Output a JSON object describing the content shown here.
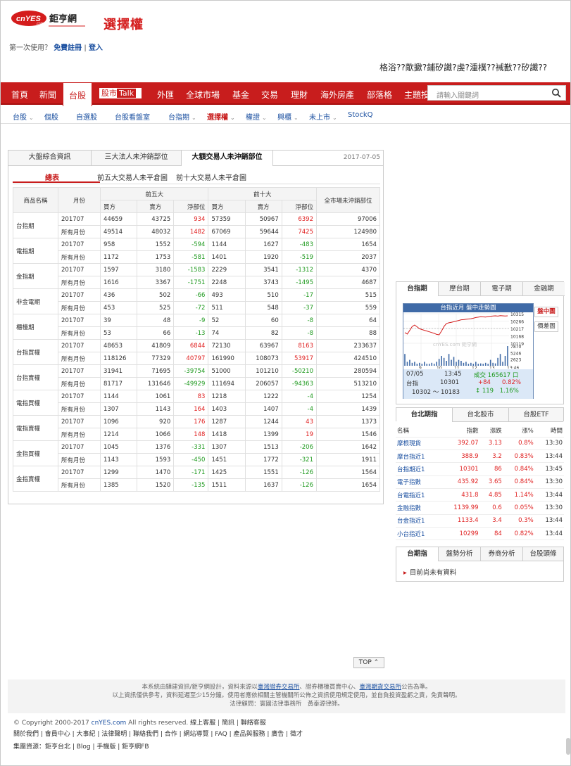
{
  "header": {
    "logo_text": "cnYES.com 鉅亨網",
    "title": "選擇權",
    "first_time": "第一次使用？",
    "register": "免費註冊",
    "sep": "|",
    "login": "登入",
    "garbled": "格浴??歒擨?鋪矽讖?虔?湩樸??裓敾??矽讖??"
  },
  "nav": {
    "items": [
      "首頁",
      "新聞",
      "台股",
      "股市",
      "外匯",
      "全球市場",
      "基金",
      "交易",
      "理財",
      "海外房產",
      "部落格",
      "主題投"
    ],
    "active": "台股",
    "talk": "Talk",
    "search_placeholder": "請輸入關鍵詞"
  },
  "subnav": [
    "台股",
    "個股",
    "自選股",
    "台股看盤室",
    "台指期",
    "選擇權",
    "權證",
    "興櫃",
    "未上市",
    "StockQ"
  ],
  "panel": {
    "tabs": [
      "大盤綜合資訊",
      "三大法人未沖銷部位",
      "大額交易人未沖銷部位"
    ],
    "date": "2017-07-05",
    "subtabs": [
      "總表",
      "前五大交易人未平倉圖",
      "前十大交易人未平倉圖"
    ]
  },
  "table": {
    "h_name": "商品名稱",
    "h_month": "月份",
    "h_top5": "前五大",
    "h_top10": "前十大",
    "h_total": "全市場未沖銷部位",
    "h_buy": "買方",
    "h_sell": "賣方",
    "h_net": "淨部位",
    "rows": [
      {
        "name": "台指期",
        "r": [
          [
            "201707",
            "44659",
            "43725",
            "934",
            "57359",
            "50967",
            "6392",
            "97006"
          ],
          [
            "所有月份",
            "49514",
            "48032",
            "1482",
            "67069",
            "59644",
            "7425",
            "124980"
          ]
        ]
      },
      {
        "name": "電指期",
        "r": [
          [
            "201707",
            "958",
            "1552",
            "-594",
            "1144",
            "1627",
            "-483",
            "1654"
          ],
          [
            "所有月份",
            "1172",
            "1753",
            "-581",
            "1401",
            "1920",
            "-519",
            "2037"
          ]
        ]
      },
      {
        "name": "金指期",
        "r": [
          [
            "201707",
            "1597",
            "3180",
            "-1583",
            "2229",
            "3541",
            "-1312",
            "4370"
          ],
          [
            "所有月份",
            "1616",
            "3367",
            "-1751",
            "2248",
            "3743",
            "-1495",
            "4687"
          ]
        ]
      },
      {
        "name": "非金電期",
        "r": [
          [
            "201707",
            "436",
            "502",
            "-66",
            "493",
            "510",
            "-17",
            "515"
          ],
          [
            "所有月份",
            "453",
            "525",
            "-72",
            "511",
            "548",
            "-37",
            "559"
          ]
        ]
      },
      {
        "name": "櫃檯期",
        "r": [
          [
            "201707",
            "39",
            "48",
            "-9",
            "52",
            "60",
            "-8",
            "64"
          ],
          [
            "所有月份",
            "53",
            "66",
            "-13",
            "74",
            "82",
            "-8",
            "88"
          ]
        ]
      },
      {
        "name": "台指買權",
        "r": [
          [
            "201707",
            "48653",
            "41809",
            "6844",
            "72130",
            "63967",
            "8163",
            "233637"
          ],
          [
            "所有月份",
            "118126",
            "77329",
            "40797",
            "161990",
            "108073",
            "53917",
            "424510"
          ]
        ]
      },
      {
        "name": "台指賣權",
        "r": [
          [
            "201707",
            "31941",
            "71695",
            "-39754",
            "51000",
            "101210",
            "-50210",
            "280594"
          ],
          [
            "所有月份",
            "81717",
            "131646",
            "-49929",
            "111694",
            "206057",
            "-94363",
            "513210"
          ]
        ]
      },
      {
        "name": "電指買權",
        "r": [
          [
            "201707",
            "1144",
            "1061",
            "83",
            "1218",
            "1222",
            "-4",
            "1254"
          ],
          [
            "所有月份",
            "1307",
            "1143",
            "164",
            "1403",
            "1407",
            "-4",
            "1439"
          ]
        ]
      },
      {
        "name": "電指賣權",
        "r": [
          [
            "201707",
            "1096",
            "920",
            "176",
            "1287",
            "1244",
            "43",
            "1373"
          ],
          [
            "所有月份",
            "1214",
            "1066",
            "148",
            "1418",
            "1399",
            "19",
            "1546"
          ]
        ]
      },
      {
        "name": "金指買權",
        "r": [
          [
            "201707",
            "1045",
            "1376",
            "-331",
            "1307",
            "1513",
            "-206",
            "1642"
          ],
          [
            "所有月份",
            "1143",
            "1593",
            "-450",
            "1451",
            "1772",
            "-321",
            "1911"
          ]
        ]
      },
      {
        "name": "金指賣權",
        "r": [
          [
            "201707",
            "1299",
            "1470",
            "-171",
            "1425",
            "1551",
            "-126",
            "1564"
          ],
          [
            "所有月份",
            "1385",
            "1520",
            "-135",
            "1511",
            "1637",
            "-126",
            "1654"
          ]
        ]
      }
    ]
  },
  "side_chart": {
    "tabs": [
      "台指期",
      "摩台期",
      "電子期",
      "金融期"
    ],
    "title": "台指近月 盤中走勢圖",
    "y_ticks": [
      "10315",
      "10266",
      "10217",
      "10168",
      "10119",
      "7870",
      "5246",
      "2623"
    ],
    "x_ticks": [
      "9",
      "10",
      "11",
      "12",
      "13",
      "13:46"
    ],
    "watermark": "cnYES.com 鉅亨網",
    "info": {
      "date": "07/05",
      "time": "13:45",
      "vol_label": "成交",
      "vol": "165617",
      "box": "口",
      "name": "台指",
      "price": "10301",
      "chg": "+84",
      "pct": "0.82%",
      "range": "10302 ～ 10183",
      "up_sym": "↕",
      "ud": "119",
      "ud_pct": "1.16%"
    },
    "btn_disk": "盤中圖",
    "btn_diff": "價差圖",
    "price_line": [
      10190,
      10180,
      10205,
      10230,
      10240,
      10228,
      10215,
      10210,
      10205,
      10200,
      10195,
      10190,
      10185,
      10178,
      10175,
      10200,
      10230,
      10250,
      10255,
      10258,
      10262,
      10266,
      10270,
      10275,
      10276,
      10278,
      10280,
      10282,
      10285,
      10290,
      10292,
      10295,
      10294,
      10293,
      10296,
      10298,
      10300,
      10301,
      10299,
      10302,
      10301,
      10300,
      10301
    ],
    "vol_bars": [
      0.6,
      0.2,
      0.3,
      0.15,
      0.2,
      0.1,
      0.15,
      0.1,
      0.2,
      0.1,
      0.1,
      0.15,
      0.1,
      0.2,
      0.35,
      0.5,
      0.4,
      0.25,
      0.6,
      0.3,
      0.45,
      0.2,
      0.3,
      0.25,
      0.15,
      0.2,
      0.1,
      0.15,
      0.1,
      0.2,
      0.1,
      0.12,
      0.1,
      0.15,
      0.1,
      0.3,
      0.15,
      0.12,
      0.4,
      0.6,
      0.2,
      0.5,
      1.0
    ]
  },
  "quotes": {
    "tabs": [
      "台北期指",
      "台北股市",
      "台股ETF"
    ],
    "headers": [
      "名稱",
      "指數",
      "漲跌",
      "漲%",
      "時間"
    ],
    "rows": [
      [
        "摩根現貨",
        "392.07",
        "3.13",
        "0.8%",
        "13:30"
      ],
      [
        "摩台指近1",
        "388.9",
        "3.2",
        "0.83%",
        "13:44"
      ],
      [
        "台指期近1",
        "10301",
        "86",
        "0.84%",
        "13:45"
      ],
      [
        "電子指數",
        "435.92",
        "3.65",
        "0.84%",
        "13:30"
      ],
      [
        "台電指近1",
        "431.8",
        "4.85",
        "1.14%",
        "13:44"
      ],
      [
        "金融指數",
        "1139.99",
        "0.6",
        "0.05%",
        "13:30"
      ],
      [
        "台金指近1",
        "1133.4",
        "3.4",
        "0.3%",
        "13:44"
      ],
      [
        "小台指近1",
        "10299",
        "84",
        "0.82%",
        "13:44"
      ]
    ]
  },
  "news": {
    "tabs": [
      "台期指",
      "盤勢分析",
      "券商分析",
      "台股頭條"
    ],
    "empty": "目前尚未有資料"
  },
  "top_button": "TOP",
  "footer": {
    "line1a": "本系統由驊建資訊/鉅亨網設計，資料來源以",
    "line1b": "臺灣證券交易所",
    "line1c": "、證券櫃檯買賣中心、",
    "line1d": "臺灣期貨交易所",
    "line1e": "公告為準。",
    "line2": "以上資訊僅供參考，資料延遲至少15分鐘。使用者應依相關主管機關所公佈之資訊使用規定使用，並自負投資盈虧之責，免責聲明。",
    "line3": "法律顧問：寰國法律事務所　黃泰源律師。",
    "copyright": "© Copyright 2000-2017",
    "brand": "cnYES.com",
    "rights": "All rights reserved.",
    "cs": "線上客服",
    "sep": "|",
    "sub": "簡訊",
    "contact": "聯絡客服",
    "links": "關於我們 | 會員中心 | 大事紀 | 法律聲明 | 聯絡我們 | 合作 | 網站導覽 | FAQ | 產品與服務 | 廣告 | 徵才",
    "group": "集團資源：鉅亨台北 | Blog | 手機版 | 鉅亨網FB"
  }
}
